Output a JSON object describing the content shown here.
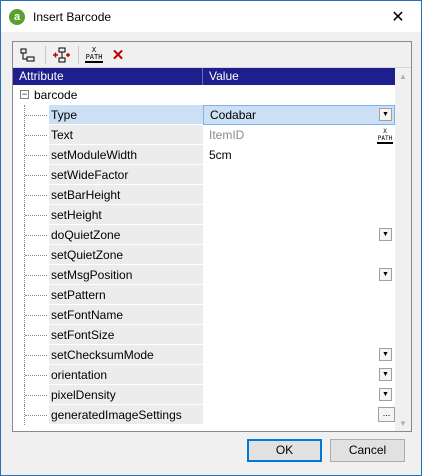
{
  "window": {
    "title": "Insert Barcode",
    "app_icon_glyph": "a",
    "close_glyph": "✕"
  },
  "toolbar": {
    "buttons": [
      {
        "name": "add-child-icon"
      },
      {
        "name": "add-attribute-icon"
      },
      {
        "name": "xpath-icon",
        "label_top": "X",
        "label_bottom": "PATH"
      },
      {
        "name": "delete-icon",
        "glyph": "✕"
      }
    ]
  },
  "grid": {
    "header_attribute": "Attribute",
    "header_value": "Value",
    "root_label": "barcode",
    "root_toggle": "−",
    "rows": [
      {
        "name": "Type",
        "value": "Codabar",
        "dropdown": true,
        "selected": true
      },
      {
        "name": "Text",
        "value": "ItemID",
        "placeholder": true,
        "xpath": true
      },
      {
        "name": "setModuleWidth",
        "value": "5cm"
      },
      {
        "name": "setWideFactor",
        "value": ""
      },
      {
        "name": "setBarHeight",
        "value": ""
      },
      {
        "name": "setHeight",
        "value": ""
      },
      {
        "name": "doQuietZone",
        "value": "",
        "dropdown": true
      },
      {
        "name": "setQuietZone",
        "value": ""
      },
      {
        "name": "setMsgPosition",
        "value": "",
        "dropdown": true
      },
      {
        "name": "setPattern",
        "value": ""
      },
      {
        "name": "setFontName",
        "value": ""
      },
      {
        "name": "setFontSize",
        "value": ""
      },
      {
        "name": "setChecksumMode",
        "value": "",
        "dropdown": true
      },
      {
        "name": "orientation",
        "value": "",
        "dropdown": true
      },
      {
        "name": "pixelDensity",
        "value": "",
        "dropdown": true
      },
      {
        "name": "generatedImageSettings",
        "value": "",
        "ellipsis": true
      }
    ],
    "dropdown_glyph": "▼",
    "ellipsis_glyph": "...",
    "xpath_label_top": "X",
    "xpath_label_bottom": "PATH"
  },
  "scrollbar": {
    "up_glyph": "▲",
    "down_glyph": "▼"
  },
  "footer": {
    "ok_label": "OK",
    "cancel_label": "Cancel"
  },
  "colors": {
    "header_bg": "#1e1e8c",
    "selection_bg": "#cce0f5",
    "accent": "#0078d7"
  }
}
